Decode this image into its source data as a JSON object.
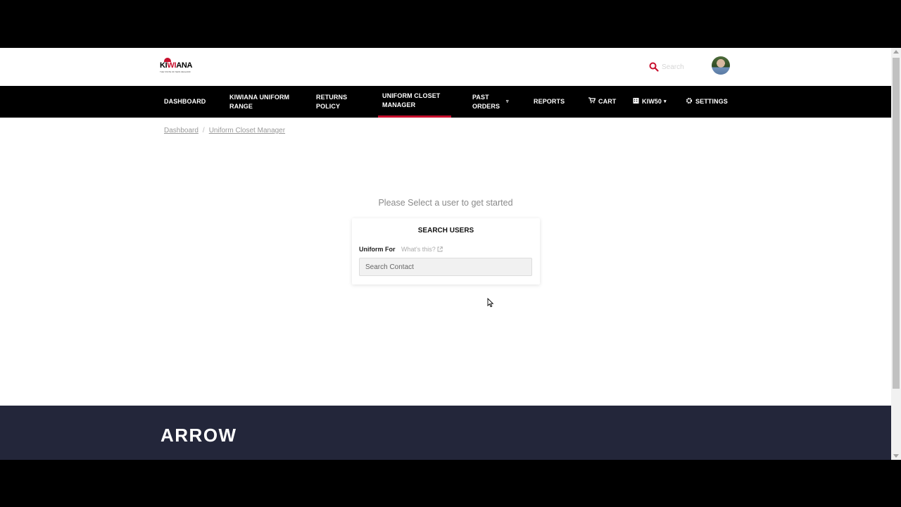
{
  "brand": {
    "logo_main_pre": "KI",
    "logo_main_red": "WI",
    "logo_main_post": "ANA",
    "logo_sub": "THE TASTE OF NEW ZEALAND"
  },
  "header": {
    "search_placeholder": "Search"
  },
  "nav": {
    "items": [
      {
        "label": "DASHBOARD"
      },
      {
        "label": "KIWIANA UNIFORM RANGE"
      },
      {
        "label": "RETURNS POLICY"
      },
      {
        "label": "UNIFORM CLOSET MANAGER",
        "active": true
      },
      {
        "label": "PAST ORDERS"
      },
      {
        "label": "REPORTS"
      },
      {
        "label": "CART"
      },
      {
        "label": "KIW50"
      },
      {
        "label": "SETTINGS"
      }
    ]
  },
  "breadcrumb": {
    "items": [
      "Dashboard",
      "Uniform Closet Manager"
    ],
    "separator": "/"
  },
  "main": {
    "prompt": "Please Select a user to get started",
    "card": {
      "title": "SEARCH USERS",
      "field_label": "Uniform For",
      "help_link": "What's this?",
      "input_placeholder": "Search Contact"
    }
  },
  "footer": {
    "logo": "ARROW"
  },
  "colors": {
    "accent_red": "#c8102e",
    "nav_bg": "#000000",
    "footer_bg": "#23263a"
  }
}
